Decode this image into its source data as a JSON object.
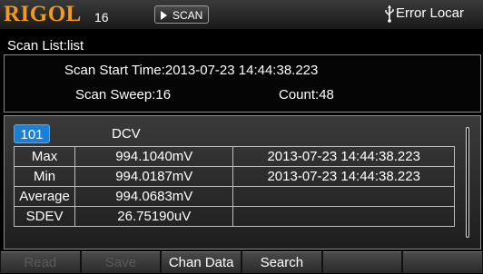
{
  "header": {
    "brand": "RIGOL",
    "brand_number": "16",
    "mode_label": "SCAN",
    "status_text": "Error Locar"
  },
  "scan_list": {
    "title": "Scan List:list",
    "start_time": "Scan Start Time:2013-07-23 14:44:38.223",
    "sweep": "Scan Sweep:16",
    "count": "Count:48"
  },
  "channel": {
    "number": "101",
    "function": "DCV"
  },
  "stats": [
    {
      "label": "Max",
      "value": "994.1040mV",
      "time": "2013-07-23 14:44:38.223"
    },
    {
      "label": "Min",
      "value": "994.0187mV",
      "time": "2013-07-23 14:44:38.223"
    },
    {
      "label": "Average",
      "value": "994.0683mV",
      "time": ""
    },
    {
      "label": "SDEV",
      "value": "26.75190uV",
      "time": ""
    }
  ],
  "softkeys": [
    {
      "label": "Read",
      "enabled": false
    },
    {
      "label": "Save",
      "enabled": false
    },
    {
      "label": "Chan Data",
      "enabled": true
    },
    {
      "label": "Search",
      "enabled": true
    },
    {
      "label": "",
      "enabled": true
    },
    {
      "label": "",
      "enabled": true
    }
  ],
  "colors": {
    "brand": "#f29a1c",
    "channel_badge": "#1c7fd1",
    "background": "#000000"
  }
}
